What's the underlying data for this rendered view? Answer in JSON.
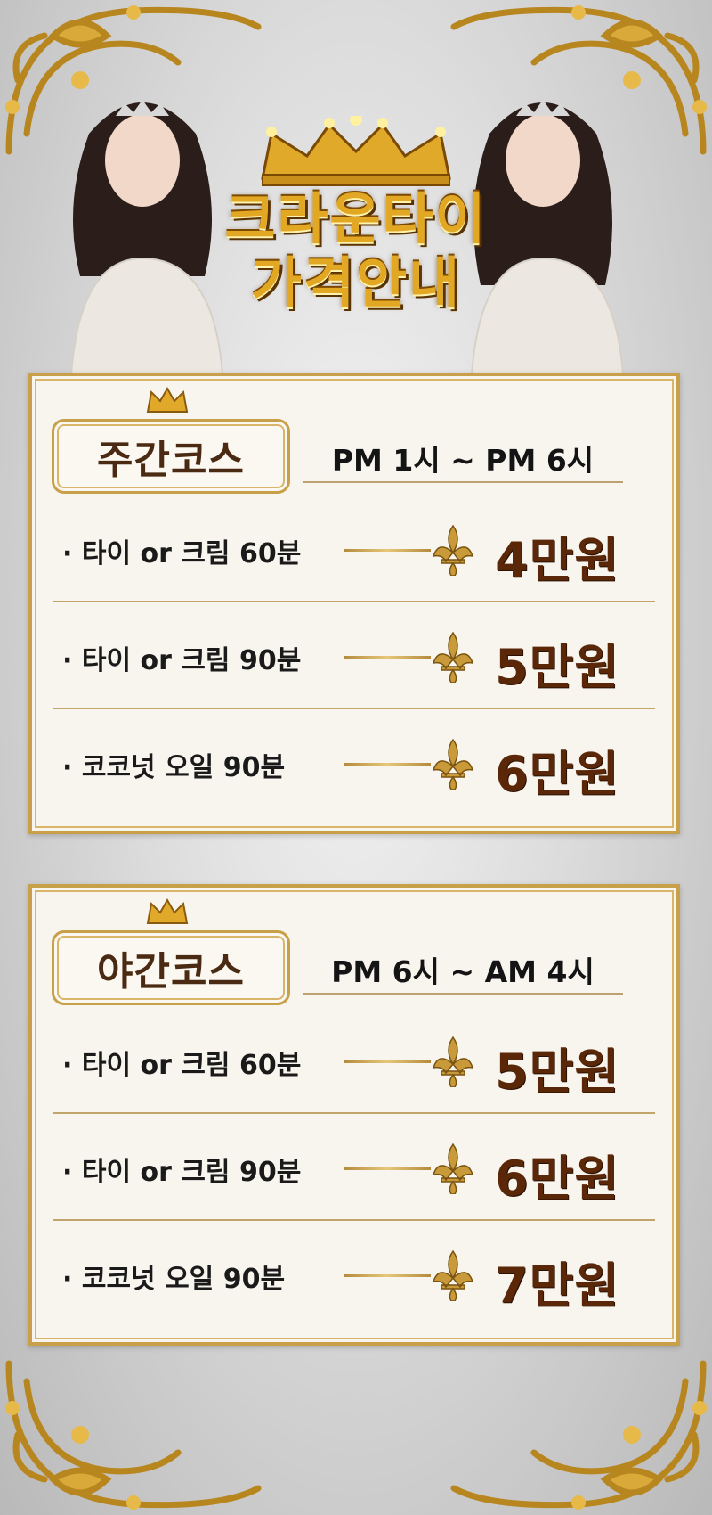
{
  "hero": {
    "title_line1": "크라운타이",
    "title_line2": "가격안내"
  },
  "courses": [
    {
      "title": "주간코스",
      "hours": "PM 1시 ~ PM 6시",
      "items": [
        {
          "label": "· 타이 or 크림 60분",
          "price": "4만원"
        },
        {
          "label": "· 타이 or 크림 90분",
          "price": "5만원"
        },
        {
          "label": "· 코코넛 오일  90분",
          "price": "6만원"
        }
      ]
    },
    {
      "title": "야간코스",
      "hours": "PM 6시 ~ AM 4시",
      "items": [
        {
          "label": "· 타이 or 크림 60분",
          "price": "5만원"
        },
        {
          "label": "· 타이 or 크림 90분",
          "price": "6만원"
        },
        {
          "label": "· 코코넛 오일  90분",
          "price": "7만원"
        }
      ]
    }
  ],
  "colors": {
    "gold": "#c9a04a",
    "title_gold": "#e2a824",
    "price_brown": "#5a2708",
    "panel_bg": "#f8f5ef"
  },
  "icons": [
    "crown-icon",
    "fleur-de-lis-icon",
    "ornament-corner-icon"
  ]
}
